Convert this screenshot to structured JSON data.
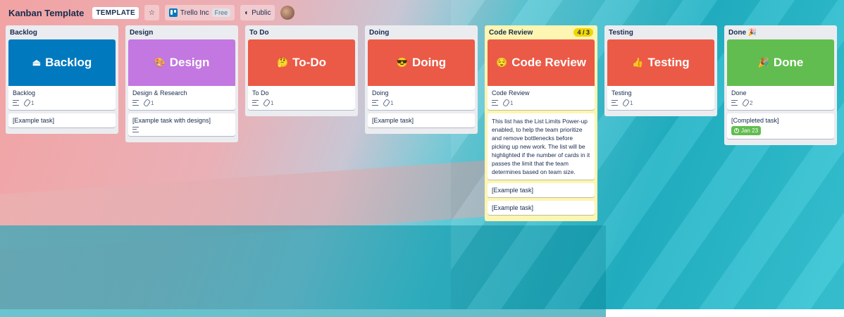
{
  "header": {
    "board_title": "Kanban Template",
    "template_badge": "TEMPLATE",
    "star": "☆",
    "workspace": "Trello Inc",
    "workspace_plan": "Free",
    "visibility": "Public",
    "visibility_icon": "◐"
  },
  "lists": [
    {
      "title": "Backlog",
      "cover_color": "#0079bf",
      "cover_emoji": "⏏",
      "cover_title": "Backlog",
      "cover_card_title": "Backlog",
      "attachments": "1",
      "tasks": [
        {
          "text": "[Example task]"
        }
      ]
    },
    {
      "title": "Design",
      "cover_color": "#c377e0",
      "cover_emoji": "🎨",
      "cover_title": "Design",
      "cover_card_title": "Design & Research",
      "attachments": "1",
      "tasks": [
        {
          "text": "[Example task with designs]",
          "has_description": true
        }
      ]
    },
    {
      "title": "To Do",
      "cover_color": "#eb5a46",
      "cover_emoji": "🤔",
      "cover_title": "To-Do",
      "cover_card_title": "To Do",
      "attachments": "1",
      "tasks": []
    },
    {
      "title": "Doing",
      "cover_color": "#eb5a46",
      "cover_emoji": "😎",
      "cover_title": "Doing",
      "cover_card_title": "Doing",
      "attachments": "1",
      "tasks": [
        {
          "text": "[Example task]"
        }
      ]
    },
    {
      "title": "Code Review",
      "limit_badge": "4 / 3",
      "cover_color": "#eb5a46",
      "cover_emoji": "😌",
      "cover_title": "Code Review",
      "cover_card_title": "Code Review",
      "attachments": "1",
      "description_card": "This list has the List Limits Power-up enabled, to help the team prioritize and remove bottlenecks before picking up new work. The list will be highlighted if the number of cards in it passes the limit that the team determines based on team size.",
      "tasks": [
        {
          "text": "[Example task]"
        },
        {
          "text": "[Example task]"
        }
      ]
    },
    {
      "title": "Testing",
      "cover_color": "#eb5a46",
      "cover_emoji": "👍",
      "cover_title": "Testing",
      "cover_card_title": "Testing",
      "attachments": "1",
      "tasks": []
    },
    {
      "title": "Done 🎉",
      "cover_color": "#61bd4f",
      "cover_emoji": "🎉",
      "cover_title": "Done",
      "cover_card_title": "Done",
      "attachments": "2",
      "tasks": [
        {
          "text": "[Completed task]",
          "due": "Jan 23"
        }
      ]
    }
  ]
}
